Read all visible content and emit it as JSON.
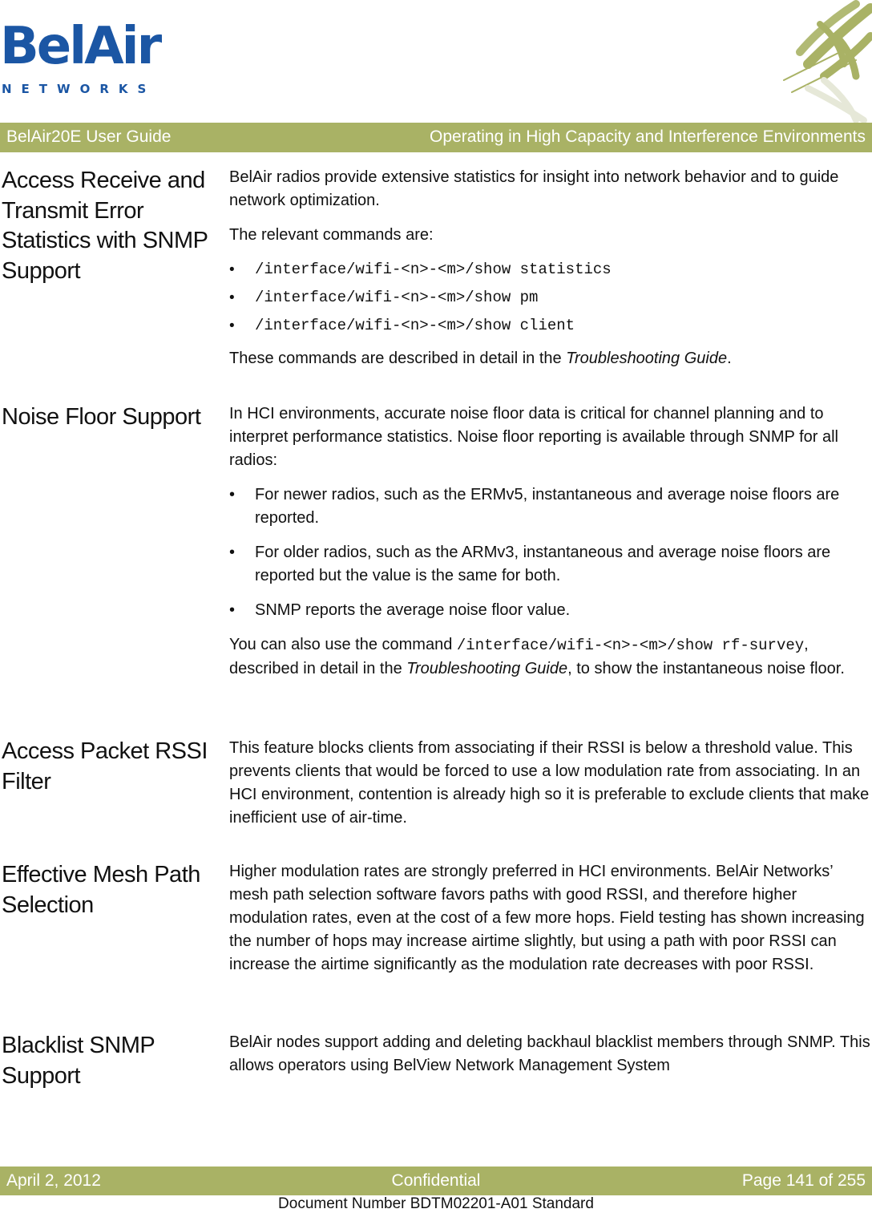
{
  "logo": {
    "name": "BelAir",
    "tagline": "NETWORKS"
  },
  "header": {
    "left": "BelAir20E User Guide",
    "right": "Operating in High Capacity and Interference Environments"
  },
  "sections": [
    {
      "title": "Access Receive and Transmit Error Statistics with SNMP Support",
      "intro": "BelAir radios provide extensive statistics for insight into network behavior and to guide network optimization.",
      "lead": "The relevant commands are:",
      "commands": [
        "/interface/wifi-<n>-<m>/show statistics",
        "/interface/wifi-<n>-<m>/show pm",
        "/interface/wifi-<n>-<m>/show client"
      ],
      "outro_prefix": "These commands are described in detail in the ",
      "outro_ref": "Troubleshooting Guide",
      "outro_suffix": "."
    },
    {
      "title": "Noise Floor Support",
      "intro": "In HCI environments, accurate noise floor data is critical for channel planning and to interpret performance statistics. Noise floor reporting is available through SNMP for all radios:",
      "bullets": [
        "For newer radios, such as the ERMv5, instantaneous and average noise floors are reported.",
        "For older radios, such as the ARMv3, instantaneous and average noise floors are reported but the value is the same for both.",
        "SNMP reports the average noise floor value."
      ],
      "outro_prefix": "You can also use the command ",
      "outro_code": "/interface/wifi-<n>-<m>/show rf-survey",
      "outro_mid": ", described in detail in the ",
      "outro_ref": "Troubleshooting Guide",
      "outro_suffix": ", to show the instantaneous noise floor."
    },
    {
      "title": "Access Packet RSSI Filter",
      "body": "This feature blocks clients from associating if their RSSI is below a threshold value. This prevents clients that would be forced to use a low modulation rate from associating.  In an HCI environment, contention is already high so it is preferable to exclude clients that make inefficient use of air-time."
    },
    {
      "title": "Effective Mesh Path Selection",
      "body": "Higher modulation rates are strongly preferred in HCI environments. BelAir Networks’ mesh path selection software favors paths with good RSSI, and therefore higher modulation rates, even at the cost of a few more hops. Field testing has shown increasing the number of hops may increase airtime slightly, but using a path with poor RSSI can increase the airtime significantly as the modulation rate decreases with poor RSSI."
    },
    {
      "title": "Blacklist SNMP Support",
      "body": "BelAir nodes support adding and deleting backhaul blacklist members through SNMP. This allows operators using BelView Network Management System"
    }
  ],
  "footer": {
    "date": "April 2, 2012",
    "classification": "Confidential",
    "page": "Page 141 of 255",
    "document_number": "Document Number BDTM02201-A01 Standard"
  },
  "colors": {
    "brand_blue": "#1b56a4",
    "bar_green": "#a9b265"
  },
  "bullet_glyph": "•"
}
